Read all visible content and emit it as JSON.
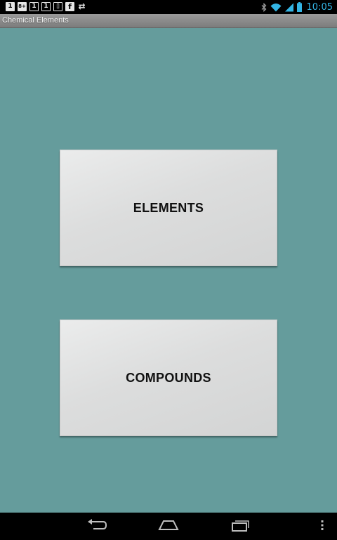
{
  "status_bar": {
    "notification_icons": [
      {
        "name": "app-notification-1-icon",
        "glyph": "1",
        "style": "light"
      },
      {
        "name": "google-plus-icon",
        "glyph": "8+",
        "style": "light"
      },
      {
        "name": "app-notification-2-icon",
        "glyph": "1",
        "style": "dark"
      },
      {
        "name": "app-notification-3-icon",
        "glyph": "1",
        "style": "dark"
      },
      {
        "name": "phone-notification-icon",
        "glyph": "▯",
        "style": "dark"
      },
      {
        "name": "facebook-icon",
        "glyph": "f",
        "style": "light"
      },
      {
        "name": "sync-icon",
        "glyph": "⇄",
        "style": "plain"
      }
    ],
    "system_icons": [
      "bluetooth-icon",
      "wifi-icon",
      "signal-icon",
      "battery-icon"
    ],
    "time": "10:05",
    "accent_color": "#33b5e5"
  },
  "title_bar": {
    "title": "Chemical Elements"
  },
  "main": {
    "background_color": "#659c9c",
    "buttons": {
      "elements_label": "ELEMENTS",
      "compounds_label": "COMPOUNDS"
    }
  },
  "nav_bar": {
    "items": [
      "back-icon",
      "home-icon",
      "recent-apps-icon",
      "overflow-menu-icon"
    ]
  }
}
